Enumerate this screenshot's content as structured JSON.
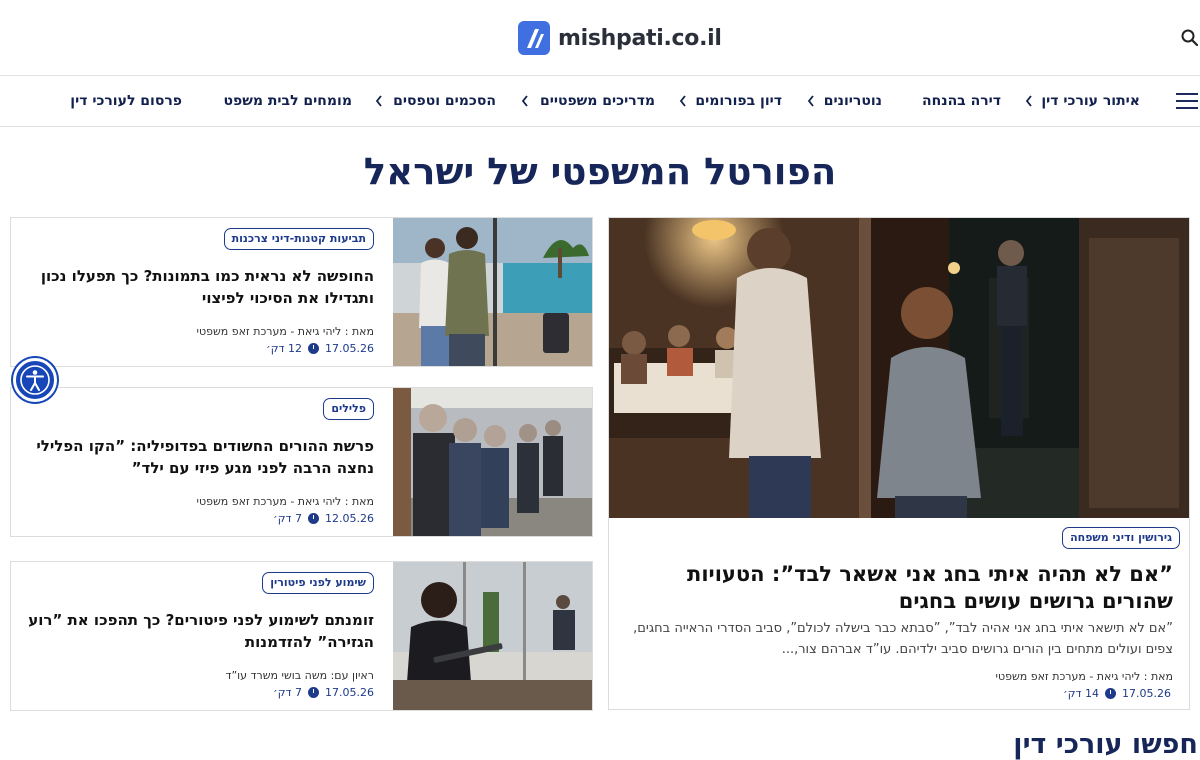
{
  "site": {
    "logo_text": "mishpati.co.il"
  },
  "nav": {
    "items": [
      "איתור עורכי דין",
      "דירה בהנחה",
      "נוטריונים",
      "דיון בפורומים",
      "מדריכים משפטיים",
      "הסכמים וטפסים",
      "מומחים לבית משפט",
      "פרסום לעורכי דין"
    ]
  },
  "main": {
    "portal_title": "הפורטל המשפטי של ישראל"
  },
  "featured": {
    "tag": "גירושין ודיני משפחה",
    "title": "”אם לא תהיה איתי בחג אני אשאר לבד”: הטעויות שהורים גרושים עושים בחגים",
    "excerpt": "”אם לא תישאר איתי בחג אני אהיה לבד”, ”סבתא כבר בישלה לכולם”, סביב הסדרי הראייה בחגים, צפים ועולים מתחים בין הורים גרושים סביב ילדיהם. עו”ד אברהם צור,...",
    "byline": "מאת : ליהי גיאת - מערכת זאפ משפטי",
    "date": "17.05.26",
    "read_time": "14 דק׳"
  },
  "cards": [
    {
      "tag": "תביעות קטנות-דיני צרכנות",
      "title": "החופשה לא נראית כמו בתמונות? כך תפעלו נכון ותגדילו את הסיכוי לפיצוי",
      "byline": "מאת : ליהי גיאת - מערכת זאפ משפטי",
      "date": "17.05.26",
      "read_time": "12 דק׳"
    },
    {
      "tag": "פלילים",
      "title": "פרשת ההורים החשודים בפדופיליה: ”הקו הפלילי נחצה הרבה לפני מגע פיזי עם ילד”",
      "byline": "מאת : ליהי גיאת - מערכת זאפ משפטי",
      "date": "12.05.26",
      "read_time": "7 דק׳"
    },
    {
      "tag": "שימוע לפני פיטורין",
      "title": "זומנתם לשימוע לפני פיטורים? כך תהפכו את ”רוע הגזירה” להזדמנות",
      "byline": "ראיון עם: משה בושי משרד עו”ד",
      "date": "17.05.26",
      "read_time": "7 דק׳"
    }
  ],
  "section": {
    "lawyers_title": "חפשו עורכי דין"
  },
  "icons": {
    "search": "search-icon",
    "menu": "hamburger-menu-icon",
    "accessibility": "accessibility-icon",
    "clock": "clock-icon",
    "chevron": "chevron-left-icon"
  },
  "colors": {
    "brand": "#172659",
    "accent": "#1e3a8a",
    "logo": "#3f6fe0",
    "a11y": "#1746b8"
  }
}
